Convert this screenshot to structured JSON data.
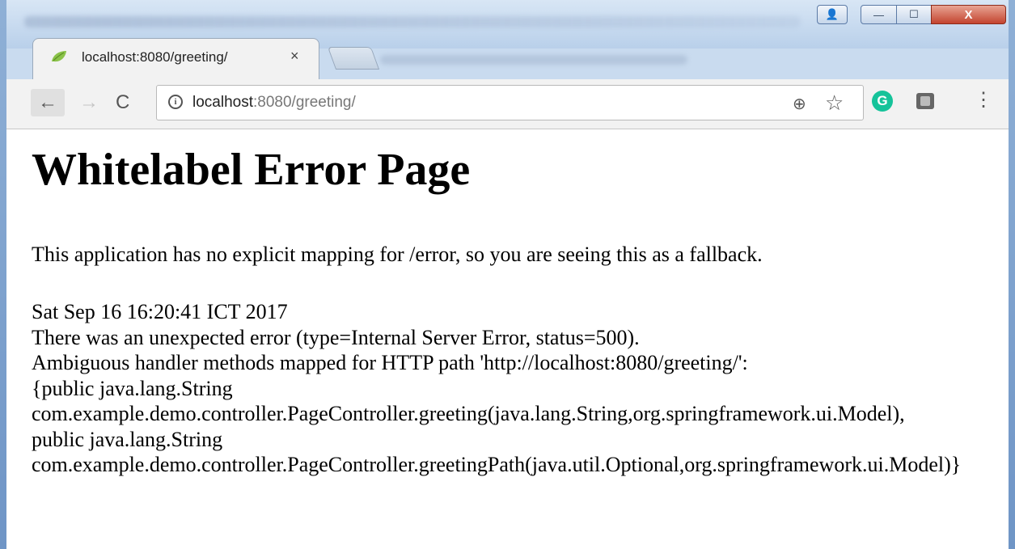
{
  "tab": {
    "title": "localhost:8080/greeting/",
    "close": "×"
  },
  "toolbar": {
    "back": "←",
    "forward": "→",
    "reload": "C",
    "info": "i",
    "url_host": "localhost",
    "url_rest": ":8080/greeting/",
    "zoom": "⊕",
    "star": "☆",
    "ext_grammarly": "G",
    "menu": "⋮"
  },
  "window": {
    "min": "—",
    "max": "☐",
    "close": "X",
    "user": "👤"
  },
  "page": {
    "heading": "Whitelabel Error Page",
    "fallback": "This application has no explicit mapping for /error, so you are seeing this as a fallback.",
    "lines": [
      "Sat Sep 16 16:20:41 ICT 2017",
      "There was an unexpected error (type=Internal Server Error, status=500).",
      "Ambiguous handler methods mapped for HTTP path 'http://localhost:8080/greeting/':",
      "{public java.lang.String",
      "com.example.demo.controller.PageController.greeting(java.lang.String,org.springframework.ui.Model),",
      "public java.lang.String",
      "com.example.demo.controller.PageController.greetingPath(java.util.Optional,org.springframework.ui.Model)}"
    ]
  }
}
